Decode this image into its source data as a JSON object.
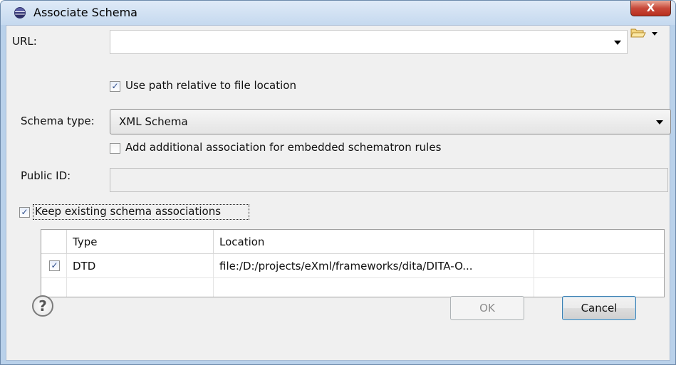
{
  "window": {
    "title": "Associate Schema",
    "close_label": "X"
  },
  "url": {
    "label": "URL:",
    "value": ""
  },
  "use_relative": {
    "label": "Use path relative to file location",
    "checked": true
  },
  "schema_type": {
    "label": "Schema type:",
    "selected": "XML Schema"
  },
  "add_schematron": {
    "label": "Add additional association for embedded schematron rules",
    "checked": false
  },
  "public_id": {
    "label": "Public ID:",
    "value": ""
  },
  "keep_existing": {
    "label": "Keep existing schema associations",
    "checked": true
  },
  "table": {
    "columns": [
      "",
      "Type",
      "Location",
      ""
    ],
    "rows": [
      {
        "checked": true,
        "type": "DTD",
        "location": "file:/D:/projects/eXml/frameworks/dita/DITA-O..."
      }
    ]
  },
  "buttons": {
    "ok_label": "OK",
    "cancel_label": "Cancel",
    "help_label": "?"
  },
  "icons": {
    "app": "eclipse-icon",
    "browse": "folder-open-icon",
    "help": "help-icon"
  }
}
